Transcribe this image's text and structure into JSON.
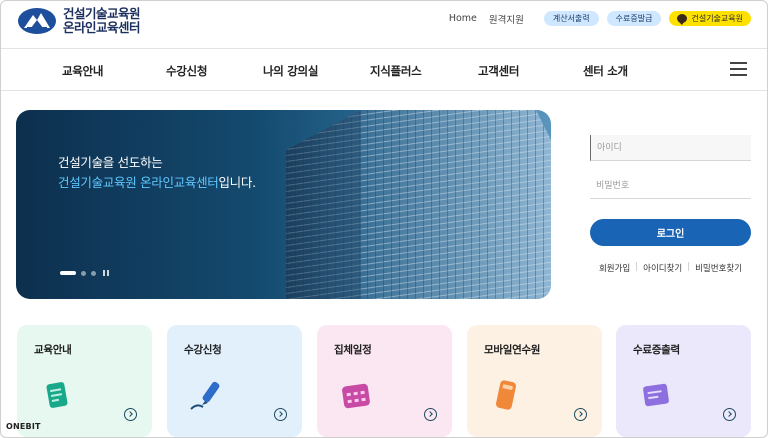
{
  "header": {
    "logo_line1": "건설기술교육원",
    "logo_line2": "온라인교육센터",
    "util_links": [
      "Home",
      "원격지원"
    ],
    "buttons": [
      "계산서출력",
      "수료증발급",
      "건설기술교육원"
    ]
  },
  "nav": {
    "items": [
      "교육안내",
      "수강신청",
      "나의 강의실",
      "지식플러스",
      "고객센터",
      "센터 소개"
    ]
  },
  "hero": {
    "line1": "건설기술을 선도하는",
    "line2_accent": "건설기술교육원 온라인교육센터",
    "line2_rest": "입니다."
  },
  "login": {
    "id_placeholder": "아이디",
    "pw_placeholder": "비밀번호",
    "button": "로그인",
    "links": [
      "회원가입",
      "아이디찾기",
      "비밀번호찾기"
    ]
  },
  "cards": [
    {
      "title": "교육안내",
      "icon": "document-icon",
      "color": "#e6f8ef"
    },
    {
      "title": "수강신청",
      "icon": "pen-icon",
      "color": "#e2f0fc"
    },
    {
      "title": "집체일정",
      "icon": "calendar-icon",
      "color": "#fbe7f1"
    },
    {
      "title": "모바일연수원",
      "icon": "mobile-icon",
      "color": "#fdf1e4"
    },
    {
      "title": "수료증출력",
      "icon": "printer-icon",
      "color": "#ebe8fb"
    }
  ],
  "footer": {
    "brand": "ONEBIT"
  },
  "colors": {
    "primary": "#1a64b5",
    "kakao": "#ffe100",
    "hero_accent": "#5ec8ff"
  }
}
